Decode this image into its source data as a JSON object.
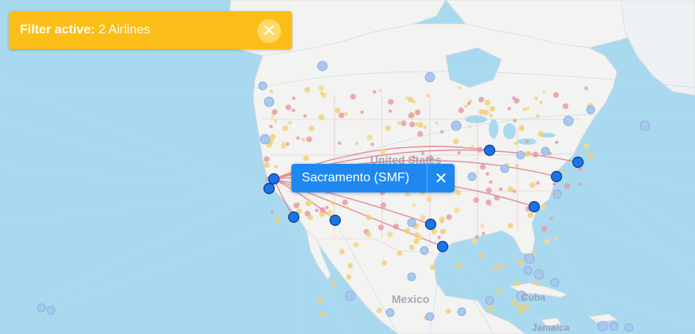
{
  "filter_banner": {
    "label": "Filter active:",
    "value": "2 Airlines",
    "close_icon": "close-icon"
  },
  "popup": {
    "label": "Sacramento (SMF)",
    "close_icon": "close-icon"
  },
  "map_labels": {
    "usa": "United States",
    "mexico": "Mexico",
    "cuba": "Cuba",
    "jamaica": "Jamaica"
  },
  "colors": {
    "ocean": "#a9d9ef",
    "land": "#f3f3f1",
    "filter_banner": "#fbbd18",
    "popup": "#1e88f0",
    "selected_airport": "#1a73e8",
    "route": "#e07b8a"
  }
}
